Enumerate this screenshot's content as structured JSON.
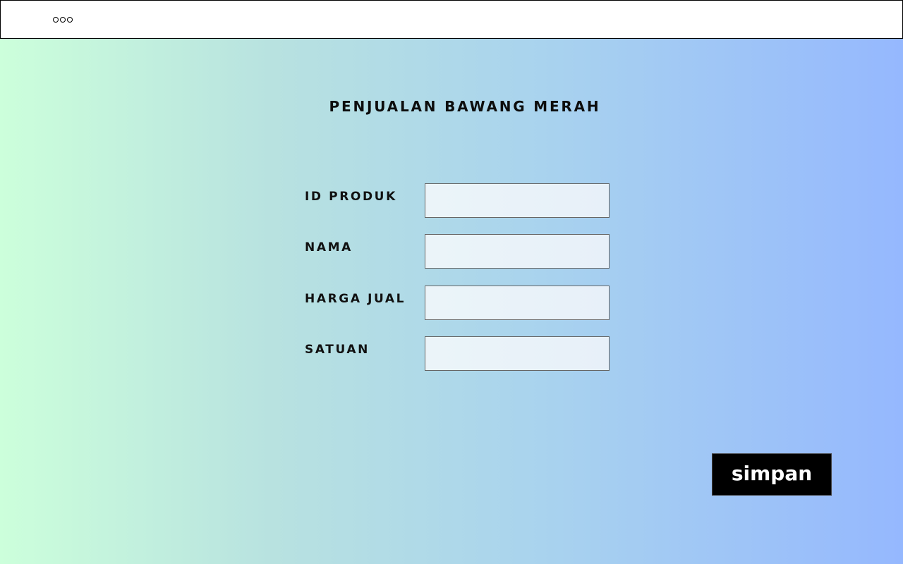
{
  "window": {
    "controls": [
      "window-dot",
      "window-dot",
      "window-dot"
    ]
  },
  "page": {
    "title": "PENJUALAN BAWANG MERAH"
  },
  "form": {
    "fields": [
      {
        "label": "ID PRODUK",
        "value": "",
        "placeholder": ""
      },
      {
        "label": "NAMA",
        "value": "",
        "placeholder": ""
      },
      {
        "label": "HARGA JUAL",
        "value": "",
        "placeholder": ""
      },
      {
        "label": "SATUAN",
        "value": "",
        "placeholder": ""
      }
    ],
    "submit_label": "simpan"
  },
  "colors": {
    "gradient_start": "#ccffdb",
    "gradient_end": "#95b8fe",
    "button_bg": "#000000",
    "button_text": "#ffffff"
  }
}
